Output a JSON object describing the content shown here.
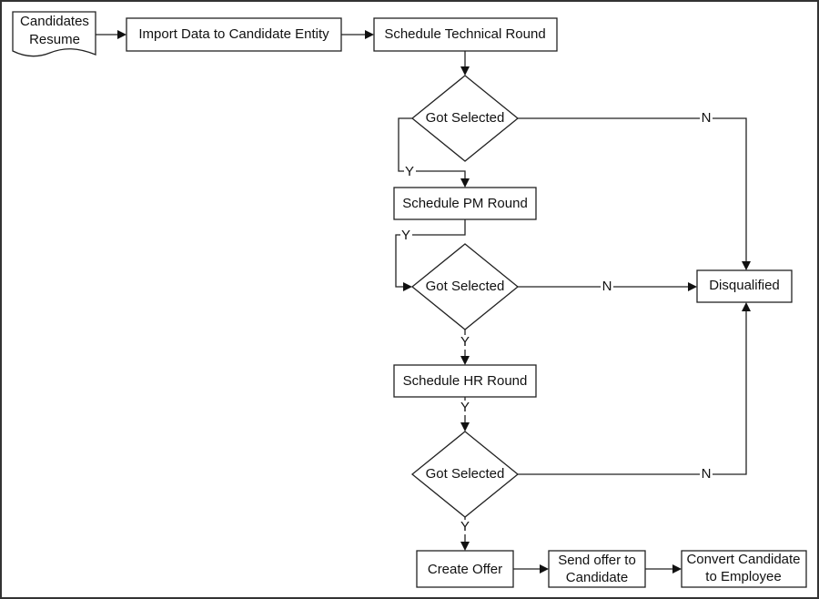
{
  "nodes": {
    "resume": "Candidates|Resume",
    "import": "Import Data to Candidate Entity",
    "tech_round": "Schedule Technical Round",
    "decision_tech": "Got Selected",
    "pm_round": "Schedule PM Round",
    "decision_pm": "Got Selected",
    "hr_round": "Schedule HR Round",
    "decision_hr": "Got Selected",
    "disqualified": "Disqualified",
    "create_offer": "Create Offer",
    "send_offer": "Send offer to|Candidate",
    "convert": "Convert Candidate|to Employee"
  },
  "edge_labels": {
    "yes": "Y",
    "no": "N"
  }
}
